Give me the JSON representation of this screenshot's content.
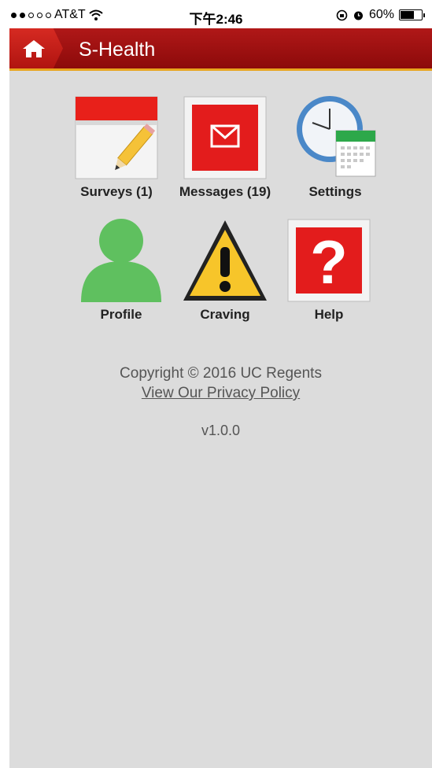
{
  "status_bar": {
    "carrier": "AT&T",
    "time": "下午2:46",
    "battery": "60%"
  },
  "header": {
    "title": "S-Health",
    "home_icon": "home-icon"
  },
  "tiles": [
    {
      "label": "Surveys (1)",
      "icon": "calendar-pencil-icon"
    },
    {
      "label": "Messages (19)",
      "icon": "envelope-icon"
    },
    {
      "label": "Settings",
      "icon": "clock-calendar-icon"
    },
    {
      "label": "Profile",
      "icon": "person-icon"
    },
    {
      "label": "Craving",
      "icon": "warning-icon"
    },
    {
      "label": "Help",
      "icon": "question-icon"
    }
  ],
  "footer": {
    "copyright": "Copyright © 2016 UC Regents",
    "privacy_link": "View Our Privacy Policy",
    "version": "v1.0.0"
  },
  "colors": {
    "header_red": "#a31212",
    "accent_orange": "#e8a51e",
    "background_gray": "#dcdcdc"
  }
}
